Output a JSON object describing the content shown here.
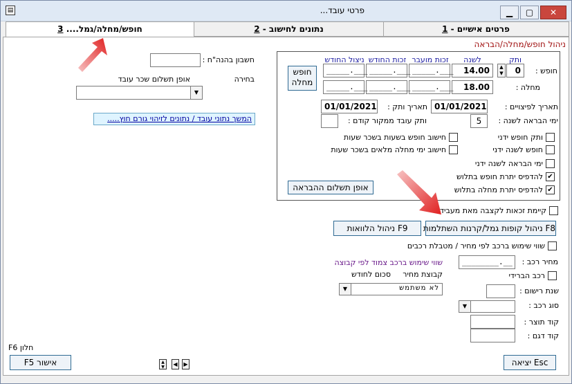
{
  "window": {
    "title": "פרטי עובד...",
    "title_suffix": ""
  },
  "tabs": [
    {
      "label": "פרטים אישיים - ",
      "num": "1"
    },
    {
      "label": "נתונים לחישוב - ",
      "num": "2"
    },
    {
      "label": "חופש/מחלה/גמל.... ",
      "num": "3"
    }
  ],
  "section_title": "ניהול חופש/מחלה/הבראה",
  "columns": {
    "tenure": "ותק",
    "yearly": "לשנה",
    "monthly_right": "זכות החודש",
    "carried": "זכות מועבר",
    "used": "ניצול החודש"
  },
  "rows": {
    "vacation": {
      "label": "חופש :",
      "tenure": "0",
      "yearly": "14.00",
      "c1": "_____.___",
      "c2": "_____.___",
      "c3": "_____.___"
    },
    "sick": {
      "label": "מחלה :",
      "yearly": "18.00",
      "c1": "_____.___",
      "c2": "_____.___",
      "c3": "_____.___"
    }
  },
  "vacation_sick_button": {
    "line1": "חופש",
    "line2": "מחלה"
  },
  "severance_date": {
    "label": "תאריך לפיצויים :",
    "value": "01/01/2021"
  },
  "tenure_date": {
    "label": "תאריך ותק :",
    "value": "01/01/2021"
  },
  "recovery_days": {
    "label": "ימי הבראה לשנה :",
    "value": "5"
  },
  "prior_tenure": {
    "label": "ותק עובד ממקור קודם :",
    "value": ""
  },
  "checkboxes": [
    {
      "label": "ותק חופש ידני",
      "checked": false
    },
    {
      "label": "חופש לשנה ידני",
      "checked": false
    },
    {
      "label": "ימי הבראה לשנה ידני",
      "checked": false
    },
    {
      "label": "להדפיס יתרת חופש בתלוש",
      "checked": true
    },
    {
      "label": "להדפיס יתרת מחלה בתלוש",
      "checked": true
    }
  ],
  "checkboxes_mid": [
    {
      "label": "חישוב חופש בשעות בשכר שעות",
      "checked": false
    },
    {
      "label": "חישוב ימי מחלה מלאים בשכר שעות",
      "checked": false
    }
  ],
  "recovery_pay_button": "אופן תשלום ההבראה",
  "bank_account": {
    "label": "חשבון בהנה\"ח :",
    "value": ""
  },
  "payment_method": {
    "label": "אופן תשלום שכר עובד",
    "choice_label": "בחירה"
  },
  "continue_link": "המשך נתוני עובד / נתונים לזיהוי גורם חוץ.....",
  "transferred_rights": {
    "label": "קיימת זכאות לקצבה מאת מעביד",
    "checked": false
  },
  "f8_button": "F8 ניהול קופות גמל/קרנות השתלמות",
  "f9_button": "F9 ניהול הלוואות",
  "car_usage": {
    "label": "שווי שימוש ברכב לפי מחיר / מטבלת רכבים",
    "checked": false
  },
  "car_price": {
    "label": "מחיר רכב :",
    "value": "________.__"
  },
  "car_group": {
    "title": "שווי שימוש ברכב צמוד לפי קבוצה",
    "col1": "קבוצת מחיר",
    "col2": "סכום לחודש",
    "value": "לא משתמש"
  },
  "hybrid_car": {
    "label": "רכב הברידי",
    "checked": false
  },
  "reg_year": {
    "label": "שנת רישום :",
    "value": ""
  },
  "car_type": {
    "label": "סוג רכב :",
    "value": ""
  },
  "manufacturer_code": {
    "label": "קוד תוצר :",
    "value": ""
  },
  "model_code": {
    "label": "קוד דגם :",
    "value": ""
  },
  "f6_window": "F6 חלון",
  "f5_button": "F5 אישור",
  "esc_button": "יציאה Esc",
  "colors": {
    "accent_red": "#a01010",
    "arrow_red": "#e02020",
    "link_blue": "#0000a0",
    "tab_bg": "#f0f0f0"
  }
}
